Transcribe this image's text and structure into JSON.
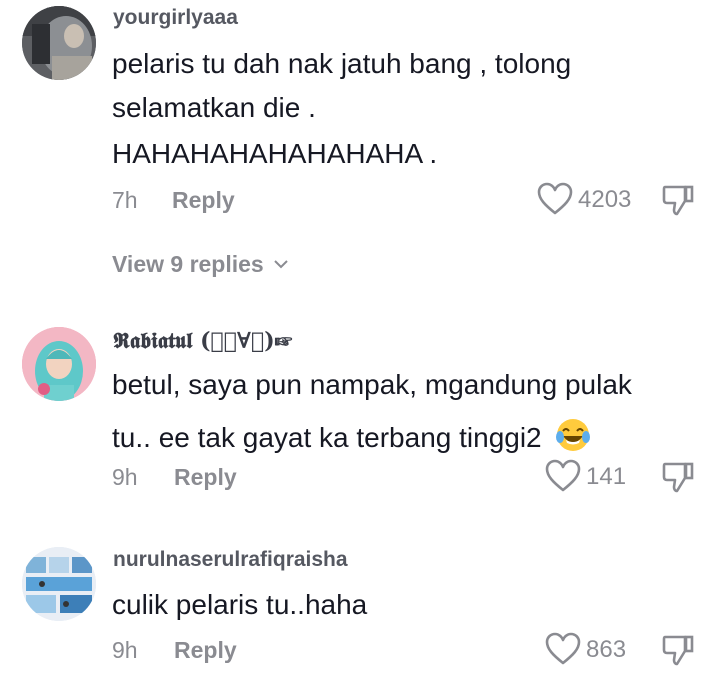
{
  "comments": [
    {
      "username": "yourgirlyaaa",
      "lines": [
        "pelaris tu dah nak jatuh bang , tolong",
        "selamatkan die .",
        "HAHAHAHAHAHAHAHA ."
      ],
      "time": "7h",
      "reply_label": "Reply",
      "likes": "4203",
      "view_replies": "View 9 replies"
    },
    {
      "username": "𝕽𝖆𝖇𝖎𝖆𝖙𝖚𝖑 (☞ﾟ∀ﾟ)☞",
      "lines": [
        "betul, saya pun nampak, mgandung pulak",
        "tu.. ee tak gayat ka terbang tinggi2"
      ],
      "emoji": "face-with-tears-of-joy",
      "time": "9h",
      "reply_label": "Reply",
      "likes": "141"
    },
    {
      "username": "nurulnaserulrafiqraisha",
      "lines": [
        "culik pelaris tu..haha"
      ],
      "time": "9h",
      "reply_label": "Reply",
      "likes": "863"
    }
  ],
  "colors": {
    "text": "#161823",
    "muted": "#8a8b91",
    "username": "#555861"
  }
}
